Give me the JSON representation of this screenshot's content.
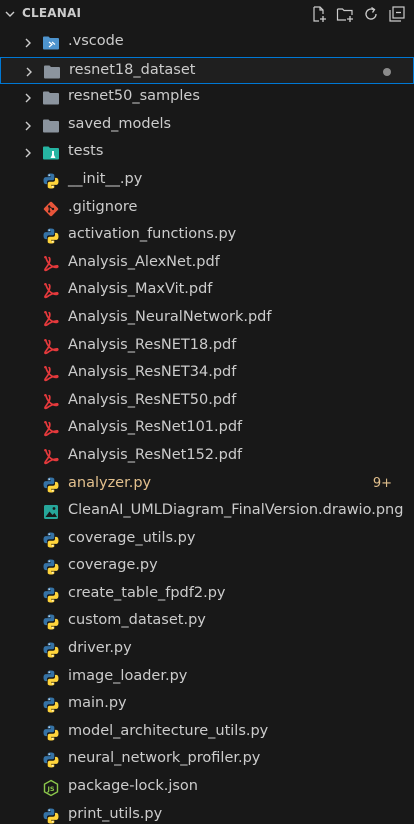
{
  "explorer": {
    "title": "CLEANAI",
    "actions": [
      {
        "name": "new-file-icon"
      },
      {
        "name": "new-folder-icon"
      },
      {
        "name": "refresh-icon"
      },
      {
        "name": "collapse-all-icon"
      }
    ]
  },
  "items": [
    {
      "label": ".vscode",
      "kind": "folder",
      "icon": "vscode-folder-icon"
    },
    {
      "label": "resnet18_dataset",
      "kind": "folder",
      "icon": "folder-icon",
      "selected": true,
      "dot": true
    },
    {
      "label": "resnet50_samples",
      "kind": "folder",
      "icon": "folder-icon"
    },
    {
      "label": "saved_models",
      "kind": "folder",
      "icon": "folder-icon"
    },
    {
      "label": "tests",
      "kind": "folder",
      "icon": "test-folder-icon"
    },
    {
      "label": "__init__.py",
      "kind": "file",
      "icon": "python-icon"
    },
    {
      "label": ".gitignore",
      "kind": "file",
      "icon": "git-icon"
    },
    {
      "label": "activation_functions.py",
      "kind": "file",
      "icon": "python-icon"
    },
    {
      "label": "Analysis_AlexNet.pdf",
      "kind": "file",
      "icon": "pdf-icon"
    },
    {
      "label": "Analysis_MaxVit.pdf",
      "kind": "file",
      "icon": "pdf-icon"
    },
    {
      "label": "Analysis_NeuralNetwork.pdf",
      "kind": "file",
      "icon": "pdf-icon"
    },
    {
      "label": "Analysis_ResNET18.pdf",
      "kind": "file",
      "icon": "pdf-icon"
    },
    {
      "label": "Analysis_ResNET34.pdf",
      "kind": "file",
      "icon": "pdf-icon"
    },
    {
      "label": "Analysis_ResNET50.pdf",
      "kind": "file",
      "icon": "pdf-icon"
    },
    {
      "label": "Analysis_ResNet101.pdf",
      "kind": "file",
      "icon": "pdf-icon"
    },
    {
      "label": "Analysis_ResNet152.pdf",
      "kind": "file",
      "icon": "pdf-icon"
    },
    {
      "label": "analyzer.py",
      "kind": "file",
      "icon": "python-icon",
      "modified": true,
      "badge": "9+"
    },
    {
      "label": "CleanAI_UMLDiagram_FinalVersion.drawio.png",
      "kind": "file",
      "icon": "image-icon"
    },
    {
      "label": "coverage_utils.py",
      "kind": "file",
      "icon": "python-icon"
    },
    {
      "label": "coverage.py",
      "kind": "file",
      "icon": "python-icon"
    },
    {
      "label": "create_table_fpdf2.py",
      "kind": "file",
      "icon": "python-icon"
    },
    {
      "label": "custom_dataset.py",
      "kind": "file",
      "icon": "python-icon"
    },
    {
      "label": "driver.py",
      "kind": "file",
      "icon": "python-icon"
    },
    {
      "label": "image_loader.py",
      "kind": "file",
      "icon": "python-icon"
    },
    {
      "label": "main.py",
      "kind": "file",
      "icon": "python-icon"
    },
    {
      "label": "model_architecture_utils.py",
      "kind": "file",
      "icon": "python-icon"
    },
    {
      "label": "neural_network_profiler.py",
      "kind": "file",
      "icon": "python-icon"
    },
    {
      "label": "package-lock.json",
      "kind": "file",
      "icon": "nodejs-icon"
    },
    {
      "label": "print_utils.py",
      "kind": "file",
      "icon": "python-icon"
    }
  ],
  "colors": {
    "background": "#181818",
    "text": "#cccccc",
    "modified": "#e2c08d",
    "selection_border": "#0078d4",
    "python_blue": "#3572a5",
    "python_yellow": "#ffd43b",
    "pdf_red": "#e5393c",
    "git_orange": "#e8553a",
    "folder_gray": "#8b949e"
  }
}
